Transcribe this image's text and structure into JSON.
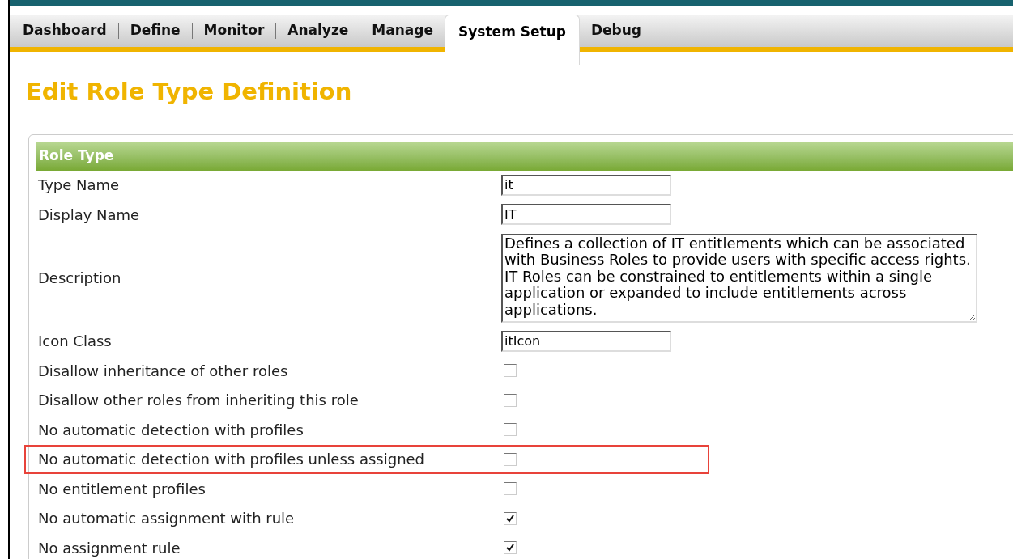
{
  "tabs": [
    {
      "label": "Dashboard",
      "selected": false
    },
    {
      "label": "Define",
      "selected": false
    },
    {
      "label": "Monitor",
      "selected": false
    },
    {
      "label": "Analyze",
      "selected": false
    },
    {
      "label": "Manage",
      "selected": false
    },
    {
      "label": "System Setup",
      "selected": true
    },
    {
      "label": "Debug",
      "selected": false
    }
  ],
  "page_title": "Edit Role Type Definition",
  "panel": {
    "title": "Role Type",
    "rows": [
      {
        "kind": "text",
        "label": "Type Name",
        "value": "it"
      },
      {
        "kind": "text",
        "label": "Display Name",
        "value": "IT"
      },
      {
        "kind": "textarea",
        "label": "Description",
        "value": "Defines a collection of IT entitlements which can be associated with Business Roles to provide users with specific access rights.  IT Roles can be constrained to entitlements within a single application or expanded to include entitlements across applications."
      },
      {
        "kind": "text",
        "label": "Icon Class",
        "value": "itIcon"
      },
      {
        "kind": "checkbox",
        "label": "Disallow inheritance of other roles",
        "checked": false,
        "highlighted": false
      },
      {
        "kind": "checkbox",
        "label": "Disallow other roles from inheriting this role",
        "checked": false,
        "highlighted": false
      },
      {
        "kind": "checkbox",
        "label": "No automatic detection with profiles",
        "checked": false,
        "highlighted": false
      },
      {
        "kind": "checkbox",
        "label": "No automatic detection with profiles unless assigned",
        "checked": false,
        "highlighted": true
      },
      {
        "kind": "checkbox",
        "label": "No entitlement profiles",
        "checked": false,
        "highlighted": false
      },
      {
        "kind": "checkbox",
        "label": "No automatic assignment with rule",
        "checked": true,
        "highlighted": false
      },
      {
        "kind": "checkbox",
        "label": "No assignment rule",
        "checked": true,
        "highlighted": false
      }
    ]
  }
}
